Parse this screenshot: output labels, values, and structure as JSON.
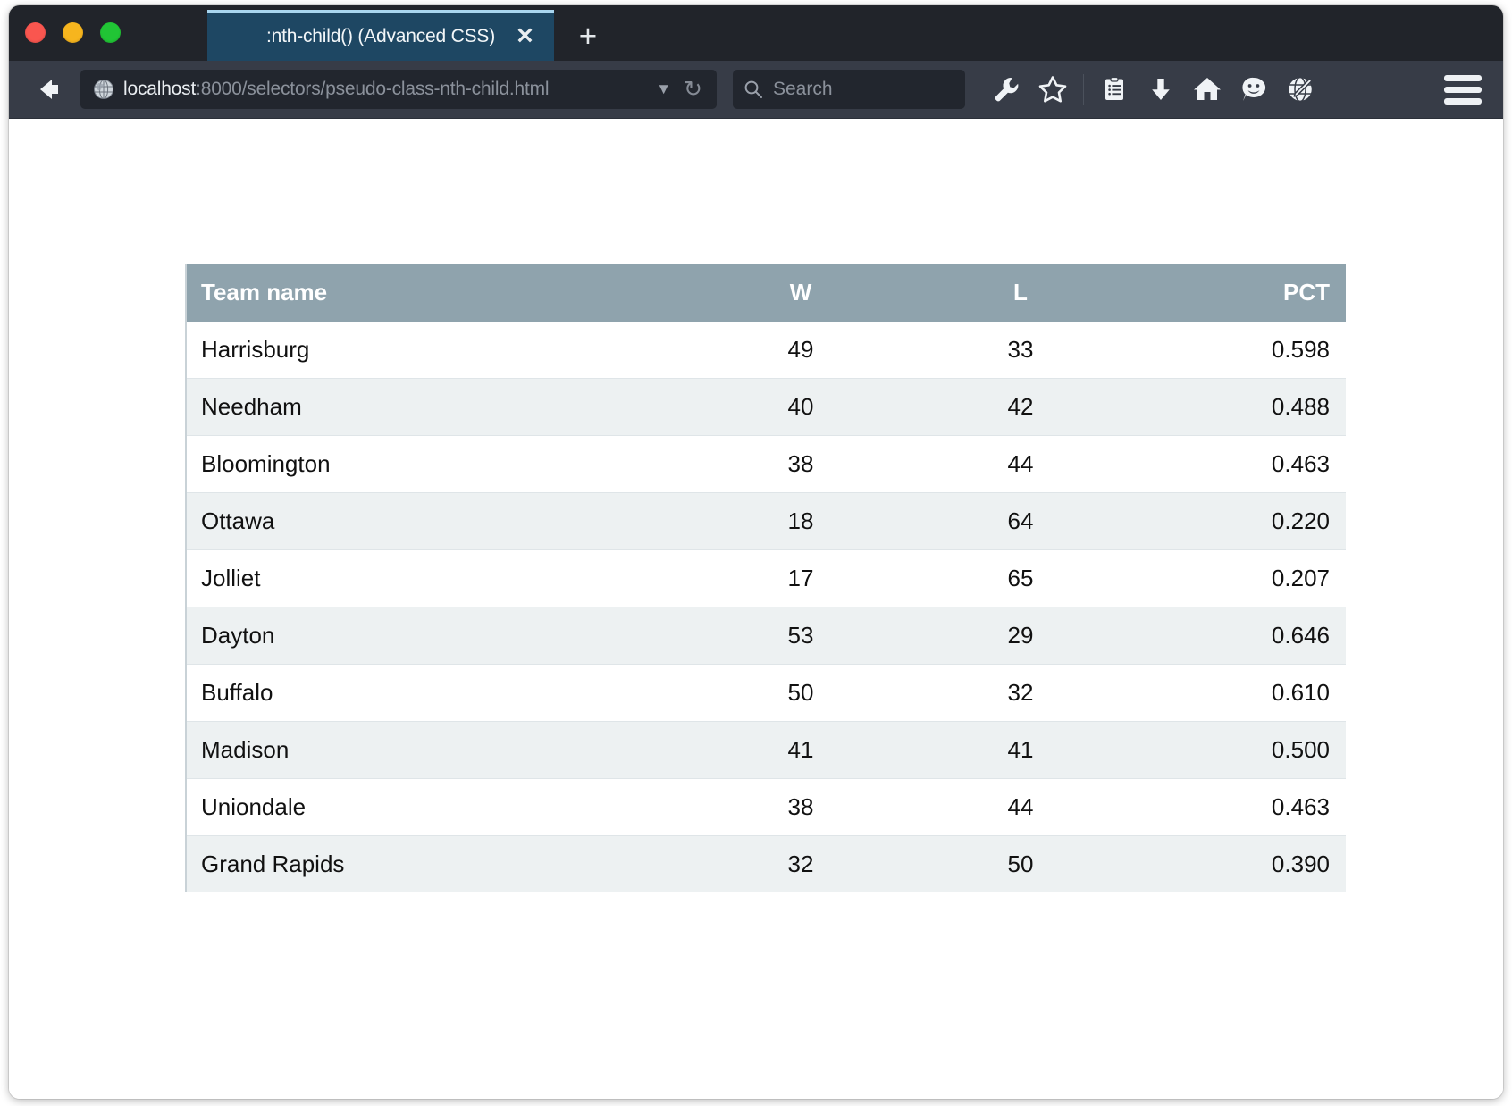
{
  "window": {
    "traffic_lights": [
      {
        "name": "close",
        "color": "#f9564f"
      },
      {
        "name": "minimize",
        "color": "#f6b51e"
      },
      {
        "name": "zoom",
        "color": "#21c535"
      }
    ]
  },
  "tabs": {
    "active": {
      "title": ":nth-child() (Advanced CSS)",
      "close_label": "✕"
    },
    "new_tab_label": "+"
  },
  "toolbar": {
    "back_icon": "back-arrow-icon",
    "url": {
      "host": "localhost",
      "path": ":8000/selectors/pseudo-class-nth-child.html",
      "full": "localhost:8000/selectors/pseudo-class-nth-child.html",
      "dropdown_label": "▼",
      "reload_label": "↻",
      "site_icon": "globe-icon"
    },
    "search": {
      "placeholder": "Search",
      "icon": "search-icon"
    },
    "buttons": [
      {
        "name": "wrench-icon",
        "label": "Developer tools"
      },
      {
        "name": "star-icon",
        "label": "Bookmark"
      },
      {
        "name": "reader-list-icon",
        "label": "Reading list"
      },
      {
        "name": "download-icon",
        "label": "Downloads"
      },
      {
        "name": "home-icon",
        "label": "Home"
      },
      {
        "name": "smiley-chat-icon",
        "label": "Feedback"
      },
      {
        "name": "globe-pencil-icon",
        "label": "Web developer"
      }
    ],
    "menu_label": "Menu"
  },
  "page": {
    "table": {
      "columns": [
        {
          "key": "team",
          "label": "Team name",
          "align": "left"
        },
        {
          "key": "w",
          "label": "W",
          "align": "center"
        },
        {
          "key": "l",
          "label": "L",
          "align": "center"
        },
        {
          "key": "pct",
          "label": "PCT",
          "align": "right"
        }
      ],
      "rows": [
        {
          "team": "Harrisburg",
          "w": "49",
          "l": "33",
          "pct": "0.598"
        },
        {
          "team": "Needham",
          "w": "40",
          "l": "42",
          "pct": "0.488"
        },
        {
          "team": "Bloomington",
          "w": "38",
          "l": "44",
          "pct": "0.463"
        },
        {
          "team": "Ottawa",
          "w": "18",
          "l": "64",
          "pct": "0.220"
        },
        {
          "team": "Jolliet",
          "w": "17",
          "l": "65",
          "pct": "0.207"
        },
        {
          "team": "Dayton",
          "w": "53",
          "l": "29",
          "pct": "0.646"
        },
        {
          "team": "Buffalo",
          "w": "50",
          "l": "32",
          "pct": "0.610"
        },
        {
          "team": "Madison",
          "w": "41",
          "l": "41",
          "pct": "0.500"
        },
        {
          "team": "Uniondale",
          "w": "38",
          "l": "44",
          "pct": "0.463"
        },
        {
          "team": "Grand Rapids",
          "w": "32",
          "l": "50",
          "pct": "0.390"
        }
      ]
    }
  },
  "colors": {
    "tab_active": "#1e4763",
    "tab_accent": "#a9d6ef",
    "chrome_dark": "#21242a",
    "toolbar": "#373c47",
    "table_header": "#8fa3ad",
    "table_stripe": "#edf1f2"
  }
}
